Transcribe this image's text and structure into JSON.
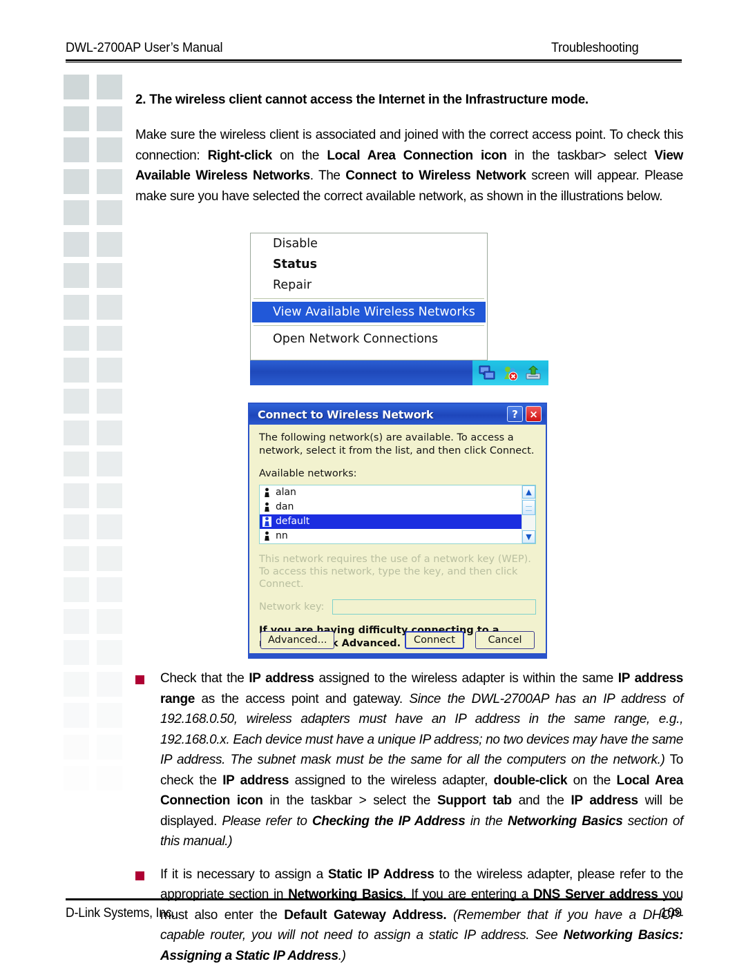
{
  "header": {
    "left": "DWL-2700AP User’s Manual",
    "right": "Troubleshooting"
  },
  "footer": {
    "company": "D-Link Systems, Inc.",
    "page_number": "109"
  },
  "content": {
    "question_title": "2. The wireless client cannot access the Internet in the Infrastructure mode.",
    "intro_paragraph": {
      "p1": "Make sure the wireless client is associated and joined with the correct access point. To check this connection: ",
      "b1": "Right-click",
      "p2": " on the ",
      "b2": "Local Area Connection icon",
      "p3": " in the taskbar> select ",
      "b3": "View Available Wireless Networks",
      "p4": ". The ",
      "b4": "Connect to Wireless Network",
      "p5": " screen will appear. Please make sure you have selected the correct available network, as shown in the illustrations below."
    },
    "bullet1": {
      "t1": "Check that the ",
      "b1": "IP address",
      "t2": " assigned to the wireless adapter is within the same ",
      "b2": "IP address range",
      "t3": " as the access point and gateway. ",
      "i1": "Since the DWL-2700AP has an IP address of 192.168.0.50, wireless adapters must have an IP address in the same range, e.g., 192.168.0.x. Each device must have a unique IP address; no two devices may have the same IP address. The subnet mask must be the same for all the computers on the network.)",
      "t4": " To check the ",
      "b3": "IP address",
      "t5": " assigned to the wireless adapter, ",
      "b4": "double-click",
      "t6": " on the ",
      "b5": "Local Area Connection icon",
      "t7": " in the taskbar > select the ",
      "b6": "Support tab",
      "t8": " and the ",
      "b7": "IP address",
      "t9": " will be displayed. ",
      "i2": "Please refer to ",
      "bi1": "Checking the IP Address",
      "i3": " in the ",
      "bi2": "Networking Basics",
      "i4": " section of this manual.)"
    },
    "bullet2": {
      "t1": "If it is necessary to assign a ",
      "b1": "Static IP Address",
      "t2": " to the wireless adapter, please refer to the appropriate section in ",
      "b2": "Networking Basics",
      "t3": ". If you are entering a ",
      "b3": "DNS Server address",
      "t4": " you must also enter the ",
      "b4": "Default Gateway Address.",
      "i1": " (Remember that if you have a DHCP-capable router, you will not need to assign a static IP address. See ",
      "bi1": "Networking Basics: Assigning a Static IP Address",
      "i2": ".)"
    }
  },
  "context_menu": {
    "items": [
      {
        "label": "Disable",
        "bold": false,
        "highlighted": false
      },
      {
        "label": "Status",
        "bold": true,
        "highlighted": false
      },
      {
        "label": "Repair",
        "bold": false,
        "highlighted": false
      },
      {
        "label": "View Available Wireless Networks",
        "bold": false,
        "highlighted": true
      },
      {
        "label": "Open Network Connections",
        "bold": false,
        "highlighted": false
      }
    ],
    "tray_icons": [
      "network-connection-icon",
      "wireless-disconnected-icon",
      "safely-remove-hardware-icon"
    ]
  },
  "dialog": {
    "title": "Connect to Wireless Network",
    "help_button": "?",
    "close_button": "×",
    "description": "The following network(s) are available. To access a network, select it from the list, and then click Connect.",
    "available_networks_label": "Available networks:",
    "networks": [
      {
        "name": "alan",
        "selected": false
      },
      {
        "name": "dan",
        "selected": false
      },
      {
        "name": "default",
        "selected": true
      },
      {
        "name": "nn",
        "selected": false
      }
    ],
    "wep_notice": "This network requires the use of a network key (WEP). To access this network, type the key, and then click Connect.",
    "network_key_label": "Network key:",
    "network_key_value": "",
    "advanced_notice": "If you are having difficulty connecting to a network, click Advanced.",
    "buttons": {
      "advanced": "Advanced...",
      "connect": "Connect",
      "cancel": "Cancel"
    }
  },
  "colors": {
    "bullet_square": "#AE0033",
    "menu_highlight": "#2158D8",
    "dialog_title_bar": "#2A53C9",
    "dialog_background": "#F2F2CF",
    "list_selection": "#1C2EE0",
    "decorative_square": "#D3DADB"
  }
}
